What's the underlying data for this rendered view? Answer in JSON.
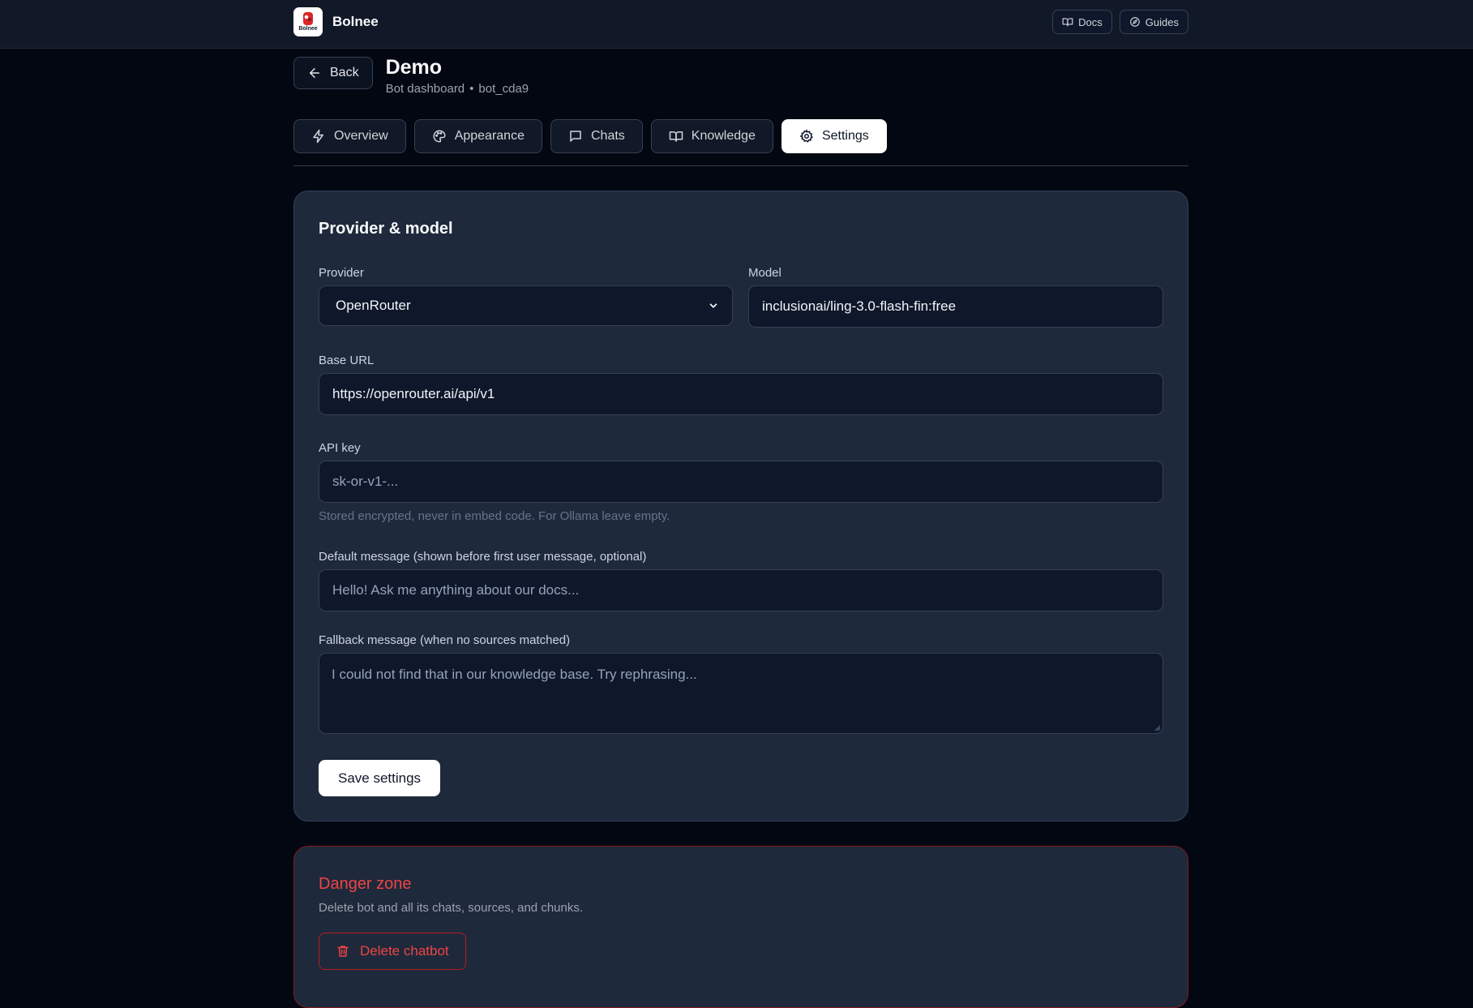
{
  "app": {
    "name": "Bolnee",
    "logo_text": "Bolnee"
  },
  "topnav": {
    "docs_label": "Docs",
    "guides_label": "Guides"
  },
  "header": {
    "back_label": "Back",
    "title": "Demo",
    "subtitle_prefix": "Bot dashboard",
    "separator": "•",
    "bot_id": "bot_cda9"
  },
  "tabs": [
    {
      "label": "Overview",
      "icon": "bolt-icon",
      "active": false
    },
    {
      "label": "Appearance",
      "icon": "palette-icon",
      "active": false
    },
    {
      "label": "Chats",
      "icon": "chat-icon",
      "active": false
    },
    {
      "label": "Knowledge",
      "icon": "book-icon",
      "active": false
    },
    {
      "label": "Settings",
      "icon": "gear-icon",
      "active": true
    }
  ],
  "settings": {
    "section_title": "Provider & model",
    "provider": {
      "label": "Provider",
      "value": "OpenRouter"
    },
    "model": {
      "label": "Model",
      "value": "inclusionai/ling-3.0-flash-fin:free"
    },
    "base_url": {
      "label": "Base URL",
      "value": "https://openrouter.ai/api/v1"
    },
    "api_key": {
      "label": "API key",
      "placeholder": "sk-or-v1-...",
      "help": "Stored encrypted, never in embed code. For Ollama leave empty."
    },
    "default_message": {
      "label": "Default message (shown before first user message, optional)",
      "placeholder": "Hello! Ask me anything about our docs..."
    },
    "fallback_message": {
      "label": "Fallback message (when no sources matched)",
      "placeholder": "I could not find that in our knowledge base. Try rephrasing..."
    },
    "save_label": "Save settings"
  },
  "danger": {
    "title": "Danger zone",
    "description": "Delete bot and all its chats, sources, and chunks.",
    "delete_label": "Delete chatbot"
  },
  "colors": {
    "background": "#030712",
    "card": "#1e293b",
    "danger": "#ef4444",
    "brand_red": "#dc2626"
  }
}
